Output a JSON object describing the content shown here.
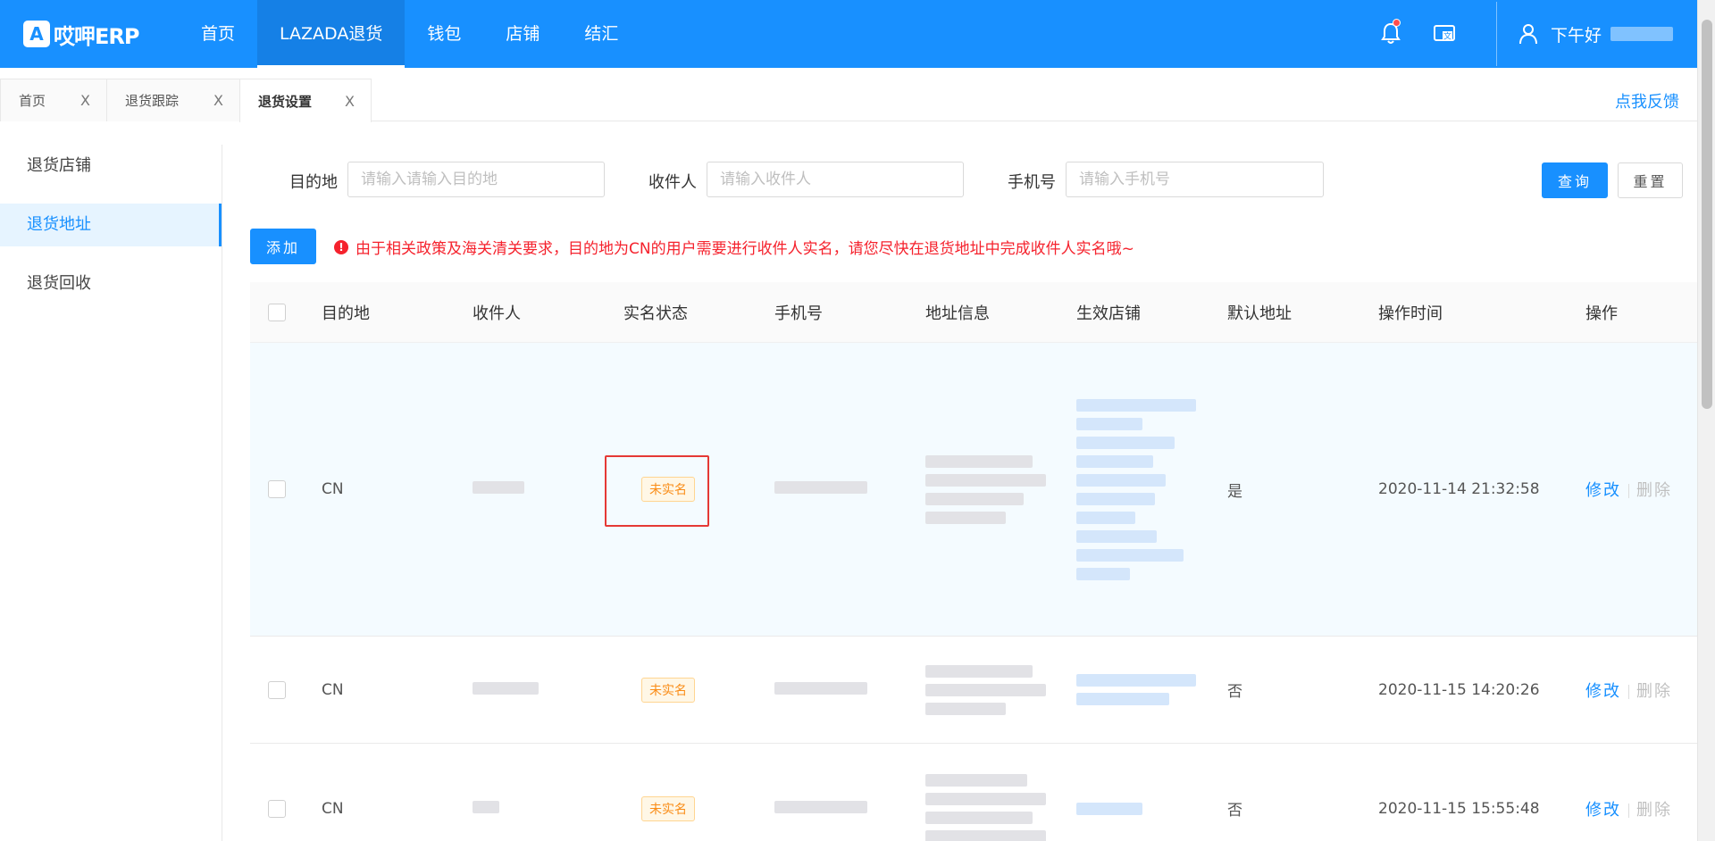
{
  "app": {
    "logo_mark": "A",
    "logo_text": "哎呷ERP"
  },
  "nav": {
    "items": [
      {
        "label": "首页"
      },
      {
        "label": "LAZADA退货"
      },
      {
        "label": "钱包"
      },
      {
        "label": "店铺"
      },
      {
        "label": "结汇"
      }
    ]
  },
  "user": {
    "greeting": "下午好"
  },
  "tabs": [
    {
      "label": "首页",
      "close": "X"
    },
    {
      "label": "退货跟踪",
      "close": "X"
    },
    {
      "label": "退货设置",
      "close": "X"
    }
  ],
  "feedback": "点我反馈",
  "sidemenu": {
    "items": [
      {
        "label": "退货店铺"
      },
      {
        "label": "退货地址"
      },
      {
        "label": "退货回收"
      }
    ]
  },
  "filters": {
    "destination": {
      "label": "目的地",
      "placeholder": "请输入请输入目的地"
    },
    "receiver": {
      "label": "收件人",
      "placeholder": "请输入收件人"
    },
    "phone": {
      "label": "手机号",
      "placeholder": "请输入手机号"
    },
    "search_button": "查询",
    "reset_button": "重置"
  },
  "add_button": "添加",
  "notice": {
    "icon": "!",
    "text": "由于相关政策及海关清关要求，目的地为CN的用户需要进行收件人实名，请您尽快在退货地址中完成收件人实名哦~"
  },
  "table": {
    "columns": [
      "目的地",
      "收件人",
      "实名状态",
      "手机号",
      "地址信息",
      "生效店铺",
      "默认地址",
      "操作时间",
      "操作"
    ],
    "rows": [
      {
        "destination": "CN",
        "status": "未实名",
        "is_default": "是",
        "time": "2020-11-14 21:32:58",
        "edit": "修改",
        "delete": "删除"
      },
      {
        "destination": "CN",
        "status": "未实名",
        "is_default": "否",
        "time": "2020-11-15 14:20:26",
        "edit": "修改",
        "delete": "删除"
      },
      {
        "destination": "CN",
        "status": "未实名",
        "is_default": "否",
        "time": "2020-11-15 15:55:48",
        "edit": "修改",
        "delete": "删除"
      }
    ]
  },
  "colors": {
    "primary": "#1890ff",
    "danger": "#f5222d",
    "warning": "#fa8c16",
    "highlight_box": "#e53935"
  },
  "icons": {
    "bell": "bell-icon",
    "translate": "translate-icon",
    "user": "user-icon",
    "info": "exclamation-circle-icon"
  }
}
